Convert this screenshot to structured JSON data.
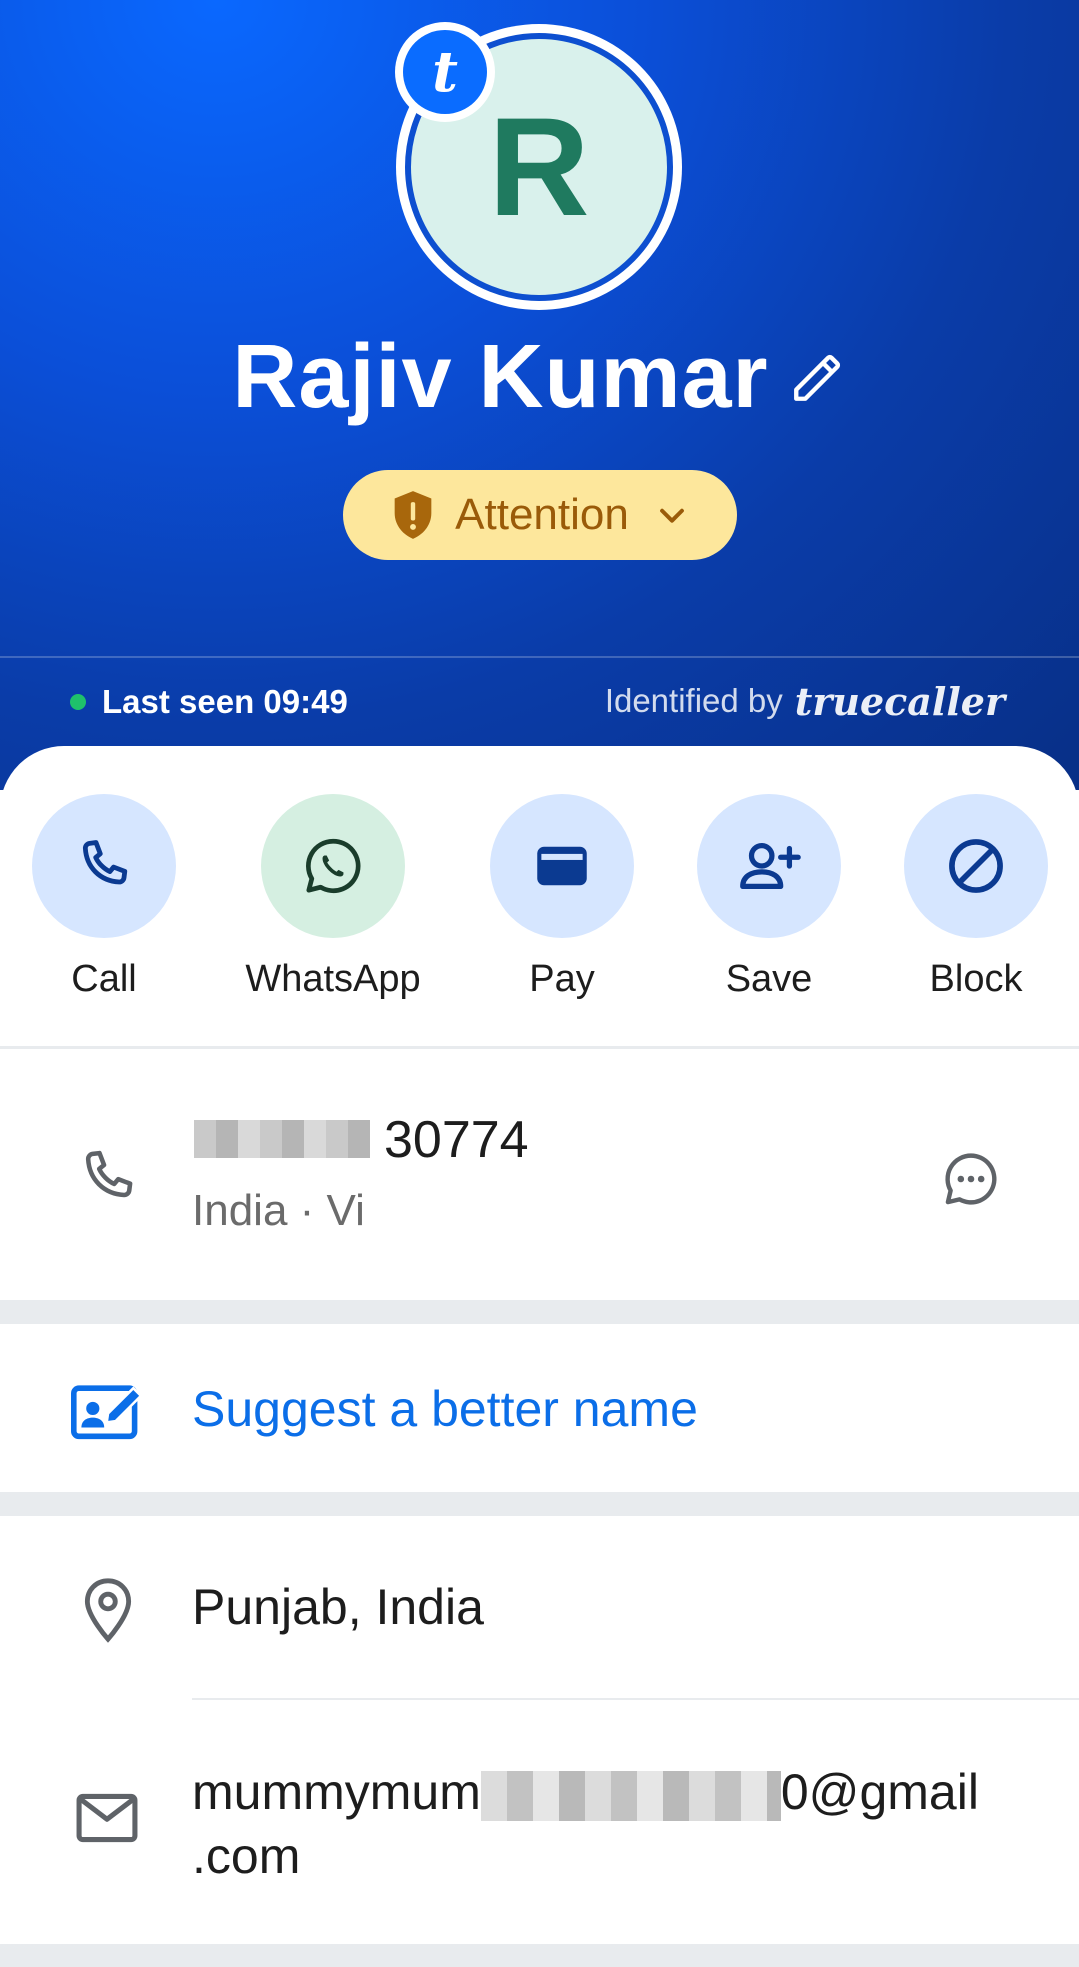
{
  "profile": {
    "initial": "R",
    "badge_letter": "t",
    "name": "Rajiv Kumar",
    "status_label": "Attention",
    "last_seen": "Last seen 09:49",
    "identified_by": "Identified by",
    "brand": "truecaller"
  },
  "actions": [
    {
      "label": "Call",
      "icon": "phone-icon"
    },
    {
      "label": "WhatsApp",
      "icon": "whatsapp-icon"
    },
    {
      "label": "Pay",
      "icon": "wallet-icon"
    },
    {
      "label": "Save",
      "icon": "add-contact-icon"
    },
    {
      "label": "Block",
      "icon": "block-icon"
    }
  ],
  "phone": {
    "number_visible": "30774",
    "carrier": "India · Vi"
  },
  "suggest": {
    "label": "Suggest a better name"
  },
  "location": {
    "text": "Punjab, India"
  },
  "email": {
    "prefix": "mummymum",
    "suffix": "0@gmail",
    "domain_end": ".com"
  },
  "colors": {
    "header_blue": "#0b4fd8",
    "accent_blue": "#0b6ee8",
    "attention_bg": "#fde79c",
    "attention_text": "#9a5b09",
    "avatar_bg": "#d9f1ec",
    "avatar_letter": "#1f7a5f"
  }
}
